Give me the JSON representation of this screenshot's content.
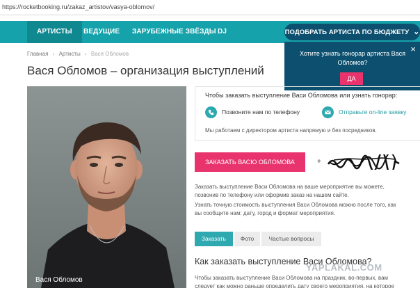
{
  "browser": {
    "url": "https://rocketbooking.ru/zakaz_artistov/vasya-oblomov/"
  },
  "nav": {
    "items": [
      {
        "label": "Артисты",
        "active": true
      },
      {
        "label": "Ведущие"
      },
      {
        "label": "Зарубежные звёзды"
      },
      {
        "label": "DJ"
      }
    ],
    "budget_button": "Подобрать артиста по бюджету",
    "budget_icon": "chevron-down-icon"
  },
  "popup": {
    "text": "Хотите узнать гонорар артиста Вася Обломов?",
    "yes_label": "ДА",
    "close_label": "×"
  },
  "breadcrumb": {
    "home": "Главная",
    "section": "Артисты",
    "current": "Вася Обломов",
    "separator": "›"
  },
  "page_title": "Вася Обломов – организация выступлений",
  "photo": {
    "caption": "Вася Обломов"
  },
  "info_box": {
    "title": "Чтобы заказать выступление Васи Обломова или узнать гонорар:",
    "call_link": "Позвоните нам по телефону",
    "request_link": "Отправьте on-line заявку",
    "note": "Мы работаем с директором артиста напрямую и без посредников.",
    "call_icon": "phone-icon",
    "request_icon": "mail-icon"
  },
  "order_button": "Заказать Васю Обломова",
  "phone_prefix": "+",
  "description": [
    "Заказать выступление Васи Обломова на ваше мероприятие вы можете,",
    "позвонив по телефону или оформив заказ на нашем сайте.",
    "Узнать точную стоимость выступления Васи Обломова можно после того, как",
    "вы сообщите нам: дату, город и формат мероприятия."
  ],
  "tabs": [
    {
      "label": "Заказать",
      "active": true
    },
    {
      "label": "Фото"
    },
    {
      "label": "Частые вопросы"
    }
  ],
  "section_heading": "Как заказать выступление Васи Обломова?",
  "section_text": [
    "Чтобы заказать выступление Васи Обломова на праздник, во-первых, вам",
    "следует как можно раньше определить дату своего мероприятия, на которое"
  ],
  "watermark": "YAPLAKAL.COM",
  "colors": {
    "teal": "#16a2aa",
    "dark_blue": "#0c4f6e",
    "pink": "#e8336c"
  }
}
